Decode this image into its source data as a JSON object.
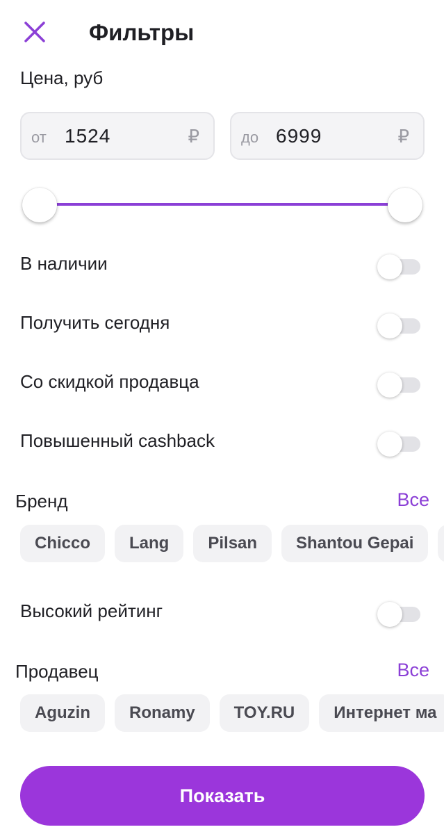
{
  "header": {
    "title": "Фильтры",
    "close_icon": "close-icon"
  },
  "price": {
    "label": "Цена, руб",
    "from_prefix": "от",
    "from_value": "1524",
    "to_prefix": "до",
    "to_value": "6999",
    "currency": "₽",
    "slider_min_fraction": 0,
    "slider_max_fraction": 1
  },
  "toggles": {
    "in_stock": {
      "label": "В наличии",
      "on": false
    },
    "today": {
      "label": "Получить сегодня",
      "on": false
    },
    "seller_discount": {
      "label": "Со скидкой продавца",
      "on": false
    },
    "cashback": {
      "label": "Повышенный cashback",
      "on": false
    },
    "high_rating": {
      "label": "Высокий рейтинг",
      "on": false
    }
  },
  "brand": {
    "label": "Бренд",
    "all_label": "Все",
    "chips": [
      "Chicco",
      "Lang",
      "Pilsan",
      "Shantou Gepai"
    ]
  },
  "seller": {
    "label": "Продавец",
    "all_label": "Все",
    "chips": [
      "Aguzin",
      "Ronamy",
      "TOY.RU",
      "Интернет ма"
    ]
  },
  "show_button": "Показать",
  "colors": {
    "accent": "#8b3fd6",
    "button": "#9b36db",
    "chip_bg": "#f2f2f4",
    "field_bg": "#f4f4f6"
  }
}
